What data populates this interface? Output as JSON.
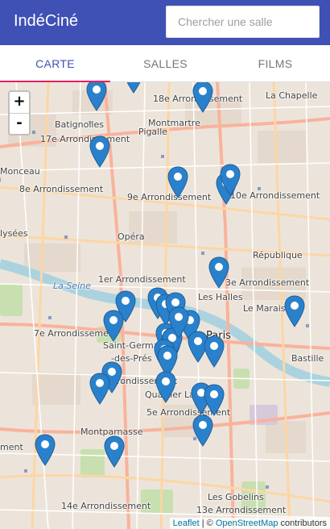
{
  "app": {
    "title": "IndéCiné"
  },
  "search": {
    "placeholder": "Chercher une salle"
  },
  "tabs": [
    {
      "label": "CARTE",
      "active": true
    },
    {
      "label": "SALLES",
      "active": false
    },
    {
      "label": "FILMS",
      "active": false
    }
  ],
  "map": {
    "zoom_in": "+",
    "zoom_out": "-",
    "labels": [
      "18e Arrondissement",
      "La Chapelle",
      "Batignolles",
      "Montmartre",
      "17e Arrondissement",
      "Pigalle",
      "Monceau",
      "8e Arrondissement",
      "9e Arrondissement",
      "10e Arrondissement",
      "lysées",
      "Opéra",
      "République",
      "1er Arrondissement",
      "3e Arrondissement",
      "Les Halles",
      "Le Marais",
      "Paris",
      "7e Arrondissement",
      "Saint-Germain",
      "-des-Prés",
      "Bastille",
      "6e Arrondissement",
      "Quartier Latin",
      "5e Arrondissement",
      "Montparnasse",
      "ment",
      "Les Gobelins",
      "14e Arrondissement",
      "13e Arrondissement",
      "La Seine"
    ],
    "attribution": {
      "leaflet": "Leaflet",
      "sep": " | © ",
      "osm": "OpenStreetMap",
      "suffix": " contributors"
    },
    "marker_icon": "map-marker-icon",
    "marker_color": "#2a81cb",
    "marker_count": 32
  }
}
